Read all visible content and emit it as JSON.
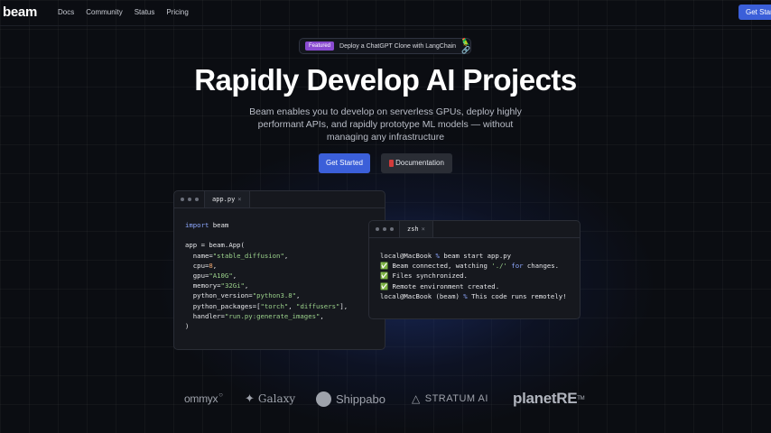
{
  "nav": {
    "logo": "beam",
    "links": [
      "Docs",
      "Community",
      "Status",
      "Pricing"
    ],
    "cta": "Get Started"
  },
  "featured": {
    "badge": "Featured",
    "text": "Deploy a ChatGPT Clone with LangChain",
    "icon": "🦜🔗"
  },
  "hero": {
    "title": "Rapidly Develop AI Projects",
    "subtitle": "Beam enables you to develop on serverless GPUs, deploy highly performant APIs, and rapidly prototype ML models — without managing any infrastructure",
    "primary_button": "Get Started",
    "secondary_button": "Documentation"
  },
  "editor": {
    "tab": "app.py",
    "close": "×",
    "lines": [
      [
        {
          "t": "import",
          "c": "kw"
        },
        {
          "t": " beam"
        }
      ],
      [
        {
          "t": ""
        }
      ],
      [
        {
          "t": "app = beam.App("
        }
      ],
      [
        {
          "t": "  name="
        },
        {
          "t": "\"stable_diffusion\"",
          "c": "str"
        },
        {
          "t": ","
        }
      ],
      [
        {
          "t": "  cpu="
        },
        {
          "t": "8",
          "c": "num"
        },
        {
          "t": ","
        }
      ],
      [
        {
          "t": "  gpu="
        },
        {
          "t": "\"A10G\"",
          "c": "str"
        },
        {
          "t": ","
        }
      ],
      [
        {
          "t": "  memory="
        },
        {
          "t": "\"32Gi\"",
          "c": "str"
        },
        {
          "t": ","
        }
      ],
      [
        {
          "t": "  python_version="
        },
        {
          "t": "\"python3.8\"",
          "c": "str"
        },
        {
          "t": ","
        }
      ],
      [
        {
          "t": "  python_packages=["
        },
        {
          "t": "\"torch\"",
          "c": "str"
        },
        {
          "t": ", "
        },
        {
          "t": "\"diffusers\"",
          "c": "str"
        },
        {
          "t": "],"
        }
      ],
      [
        {
          "t": "  handler="
        },
        {
          "t": "\"run.py:generate_images\"",
          "c": "str"
        },
        {
          "t": ","
        }
      ],
      [
        {
          "t": ")"
        }
      ]
    ]
  },
  "terminal": {
    "tab": "zsh",
    "close": "×",
    "lines": [
      [
        {
          "t": "local@MacBook "
        },
        {
          "t": "%",
          "c": "kw"
        },
        {
          "t": " beam start app.py"
        }
      ],
      [
        {
          "t": "✅ Beam connected, watching "
        },
        {
          "t": "'./'",
          "c": "str"
        },
        {
          "t": " "
        },
        {
          "t": "for",
          "c": "kw"
        },
        {
          "t": " changes."
        }
      ],
      [
        {
          "t": "✅ Files synchronized."
        }
      ],
      [
        {
          "t": "✅ Remote environment created."
        }
      ],
      [
        {
          "t": "local@MacBook (beam) "
        },
        {
          "t": "%",
          "c": "kw"
        },
        {
          "t": " This code runs remotely!"
        }
      ]
    ]
  },
  "logos": {
    "ommyx": "ommyx",
    "galaxy": "Galaxy",
    "shippabo": "Shippabo",
    "stratum": "STRATUM AI",
    "planet": "planetRE",
    "planet_tm": "TM"
  }
}
